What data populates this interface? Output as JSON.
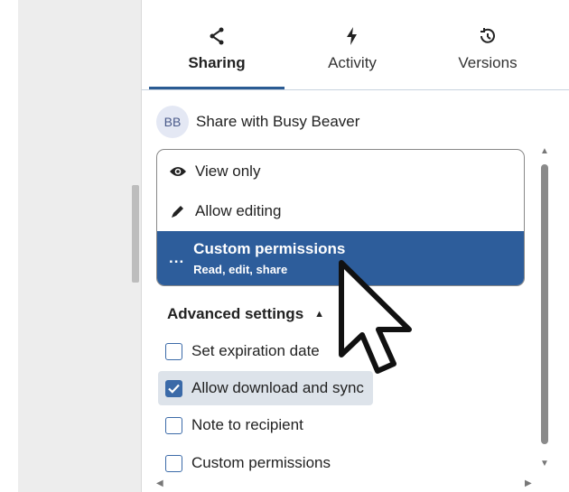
{
  "tabs": [
    {
      "label": "Sharing",
      "icon": "share-icon",
      "active": true
    },
    {
      "label": "Activity",
      "icon": "bolt-icon",
      "active": false
    },
    {
      "label": "Versions",
      "icon": "history-icon",
      "active": false
    }
  ],
  "share": {
    "avatar_initials": "BB",
    "label": "Share with Busy Beaver"
  },
  "permissions": {
    "view_only": "View only",
    "allow_editing": "Allow editing",
    "custom_dots": "...",
    "custom_title": "Custom permissions",
    "custom_subtitle": "Read, edit, share",
    "selected": "custom"
  },
  "advanced": {
    "label": "Advanced settings",
    "caret": "▲",
    "options": [
      {
        "label": "Set expiration date",
        "checked": false
      },
      {
        "label": "Allow download and sync",
        "checked": true
      },
      {
        "label": "Note to recipient",
        "checked": false
      },
      {
        "label": "Custom permissions",
        "checked": false
      }
    ]
  },
  "colors": {
    "accent": "#2d5d9b",
    "checkbox": "#3b6aa8",
    "highlight_row": "#dde3ea"
  }
}
